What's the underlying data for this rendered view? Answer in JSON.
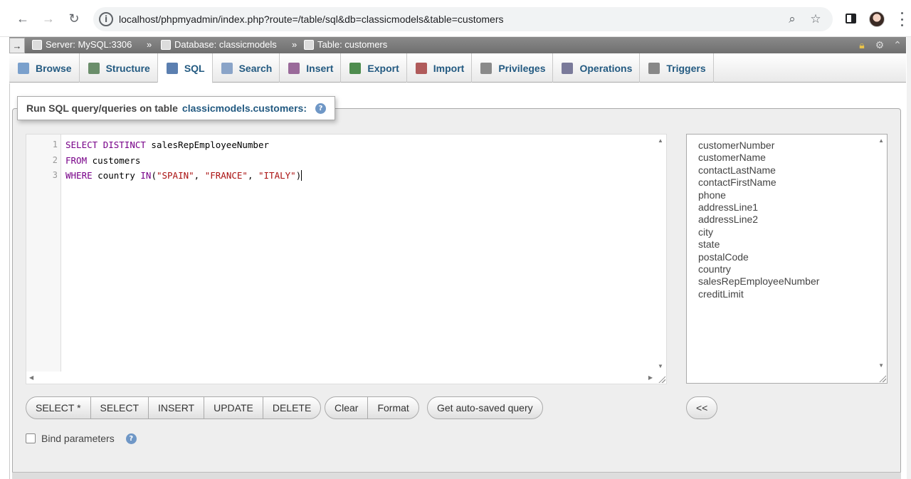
{
  "browser": {
    "url": "localhost/phpmyadmin/index.php?route=/table/sql&db=classicmodels&table=customers",
    "nav_icons": [
      "back-arrow-icon",
      "forward-arrow-icon",
      "reload-icon"
    ],
    "actions": [
      "zoom-icon",
      "star-icon",
      "sidepanel-icon",
      "profile-avatar",
      "menu-icon"
    ]
  },
  "breadcrumb": {
    "arrow": "→",
    "server": "Server: MySQL:3306",
    "database": "Database: classicmodels",
    "table": "Table: customers",
    "separator": "»"
  },
  "tabs": [
    {
      "label": "Browse",
      "icon": "browse-icon",
      "color": "#7aa0cc"
    },
    {
      "label": "Structure",
      "icon": "structure-icon",
      "color": "#6b8e6b"
    },
    {
      "label": "SQL",
      "icon": "sql-icon",
      "color": "#5b7fb0",
      "active": true
    },
    {
      "label": "Search",
      "icon": "search-icon",
      "color": "#8aa4c8"
    },
    {
      "label": "Insert",
      "icon": "insert-icon",
      "color": "#9a6a9a"
    },
    {
      "label": "Export",
      "icon": "export-icon",
      "color": "#4e8c4e"
    },
    {
      "label": "Import",
      "icon": "import-icon",
      "color": "#b05b5b"
    },
    {
      "label": "Privileges",
      "icon": "privileges-icon",
      "color": "#8a8a8a"
    },
    {
      "label": "Operations",
      "icon": "wrench-icon",
      "color": "#7a7a9a"
    },
    {
      "label": "Triggers",
      "icon": "triggers-icon",
      "color": "#888888"
    }
  ],
  "query_panel": {
    "legend_prefix": "Run SQL query/queries on table ",
    "legend_table": "classicmodels.customers:",
    "help": "?"
  },
  "editor": {
    "lines": [
      {
        "no": "1",
        "tokens": [
          {
            "t": "SELECT",
            "c": "kw"
          },
          {
            "t": " "
          },
          {
            "t": "DISTINCT",
            "c": "kw"
          },
          {
            "t": " salesRepEmployeeNumber"
          }
        ]
      },
      {
        "no": "2",
        "tokens": [
          {
            "t": "FROM",
            "c": "kw"
          },
          {
            "t": " customers"
          }
        ]
      },
      {
        "no": "3",
        "tokens": [
          {
            "t": "WHERE",
            "c": "kw"
          },
          {
            "t": " country "
          },
          {
            "t": "IN",
            "c": "kw"
          },
          {
            "t": "("
          },
          {
            "t": "\"SPAIN\"",
            "c": "str"
          },
          {
            "t": ", "
          },
          {
            "t": "\"FRANCE\"",
            "c": "str"
          },
          {
            "t": ", "
          },
          {
            "t": "\"ITALY\"",
            "c": "str"
          },
          {
            "t": ")"
          }
        ]
      }
    ]
  },
  "columns": [
    "customerNumber",
    "customerName",
    "contactLastName",
    "contactFirstName",
    "phone",
    "addressLine1",
    "addressLine2",
    "city",
    "state",
    "postalCode",
    "country",
    "salesRepEmployeeNumber",
    "creditLimit"
  ],
  "buttons": {
    "templates": [
      "SELECT *",
      "SELECT",
      "INSERT",
      "UPDATE",
      "DELETE"
    ],
    "edit": [
      "Clear",
      "Format"
    ],
    "autosaved": "Get auto-saved query",
    "insert_column": "<<"
  },
  "bind_parameters": {
    "label": "Bind parameters",
    "checked": false
  }
}
